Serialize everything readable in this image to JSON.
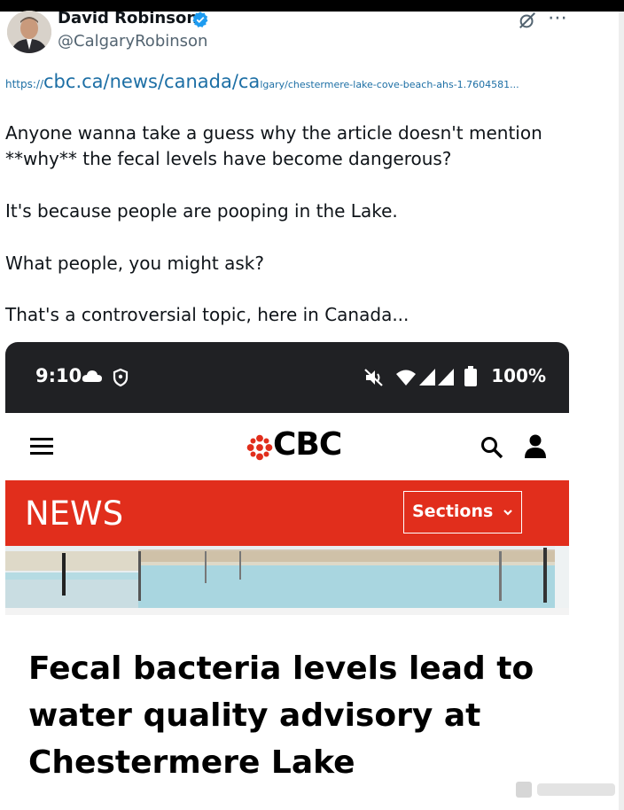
{
  "tweet": {
    "author_name": "David Robinson",
    "handle": "@CalgaryRobinson",
    "link": {
      "prefix": "https://",
      "domain": "cbc.ca/news/canada/ca",
      "rest": "lgary/chestermere-lake-cove-beach-ahs-1.7604581..."
    },
    "lines": [
      "Anyone wanna take a guess why the article doesn't mention",
      "**why** the fecal levels have become dangerous?",
      "It's because people are pooping in the Lake.",
      "What people, you might ask?",
      "That's a controversial topic, here in Canada..."
    ]
  },
  "screenshot": {
    "status_time": "9:10",
    "battery": "100%",
    "brand": "CBC",
    "section_label": "NEWS",
    "sections_button": "Sections",
    "headline_lines": [
      "Fecal bacteria levels lead to",
      "water quality advisory at",
      "Chestermere Lake"
    ]
  },
  "colors": {
    "cbc_red": "#e12e1c",
    "link_blue": "#1d6fa5",
    "verified_blue": "#1d9bf0",
    "status_bar": "#202124"
  },
  "icons": [
    "verified-icon",
    "grok-icon",
    "more-icon",
    "cloud-icon",
    "shield-icon",
    "mute-icon",
    "wifi-icon",
    "signal-icon",
    "battery-icon",
    "hamburger-icon",
    "cbc-logo-icon",
    "search-icon",
    "user-icon",
    "chevron-down-icon"
  ]
}
